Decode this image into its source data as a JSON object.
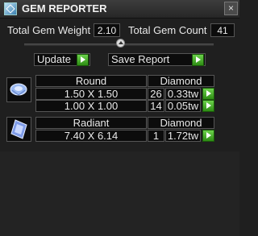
{
  "window": {
    "title": "GEM REPORTER",
    "close_glyph": "×"
  },
  "icons": {
    "app": "gem-app-icon",
    "close": "close-icon",
    "go": "green-arrow-icon",
    "round": "round-diamond-icon",
    "radiant": "radiant-diamond-icon"
  },
  "stats": {
    "weight_label": "Total Gem Weight",
    "weight_value": "2.10",
    "count_label": "Total Gem Count",
    "count_value": "41"
  },
  "actions": {
    "update_label": "Update",
    "save_label": "Save Report"
  },
  "groups": [
    {
      "shape": "Round",
      "type": "Diamond",
      "rows": [
        {
          "size": "1.50 X 1.50",
          "count": "26",
          "weight": "0.33tw"
        },
        {
          "size": "1.00 X 1.00",
          "count": "14",
          "weight": "0.05tw"
        }
      ]
    },
    {
      "shape": "Radiant",
      "type": "Diamond",
      "rows": [
        {
          "size": "7.40 X 6.14",
          "count": "1",
          "weight": "1.72tw"
        }
      ]
    }
  ]
}
